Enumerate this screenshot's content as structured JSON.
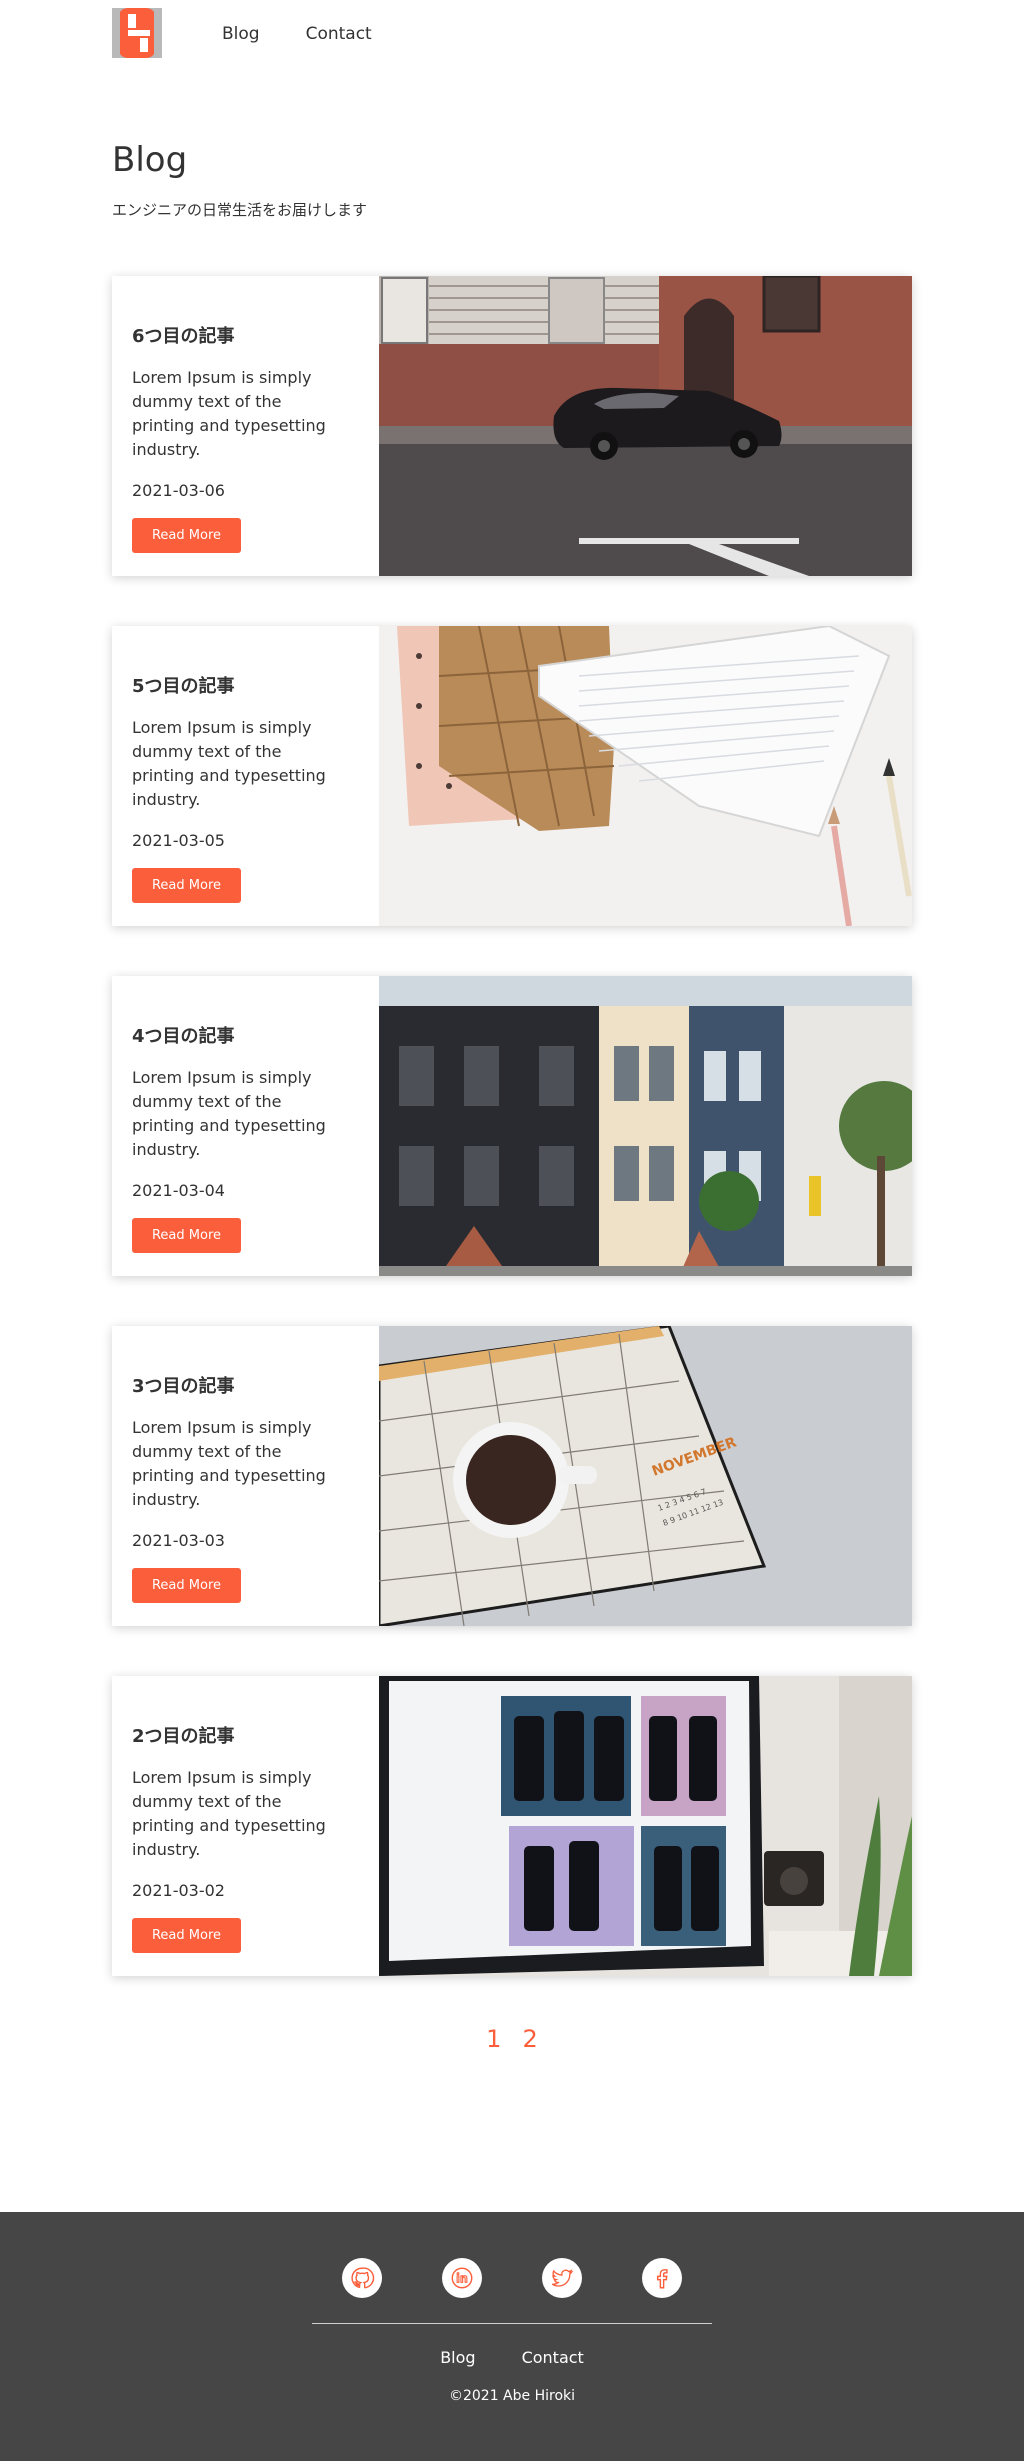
{
  "header": {
    "logo_alt": "H",
    "nav": [
      {
        "label": "Blog"
      },
      {
        "label": "Contact"
      }
    ]
  },
  "hero": {
    "title": "Blog",
    "subtitle": "エンジニアの日常生活をお届けします"
  },
  "posts": [
    {
      "title": "6つ目の記事",
      "excerpt": "Lorem Ipsum is simply dummy text of the printing and typesetting industry.",
      "date": "2021-03-06",
      "button": "Read More",
      "image": "street-car-photo"
    },
    {
      "title": "5つ目の記事",
      "excerpt": "Lorem Ipsum is simply dummy text of the printing and typesetting industry.",
      "date": "2021-03-05",
      "button": "Read More",
      "image": "notebooks-pens-photo"
    },
    {
      "title": "4つ目の記事",
      "excerpt": "Lorem Ipsum is simply dummy text of the printing and typesetting industry.",
      "date": "2021-03-04",
      "button": "Read More",
      "image": "row-houses-photo"
    },
    {
      "title": "3つ目の記事",
      "excerpt": "Lorem Ipsum is simply dummy text of the printing and typesetting industry.",
      "date": "2021-03-03",
      "button": "Read More",
      "image": "coffee-calendar-photo"
    },
    {
      "title": "2つ目の記事",
      "excerpt": "Lorem Ipsum is simply dummy text of the printing and typesetting industry.",
      "date": "2021-03-02",
      "button": "Read More",
      "image": "monitor-design-photo"
    }
  ],
  "pagination": {
    "pages": [
      "1",
      "2"
    ],
    "current": "1"
  },
  "footer": {
    "socials": [
      {
        "name": "github-icon"
      },
      {
        "name": "linkedin-icon"
      },
      {
        "name": "twitter-icon"
      },
      {
        "name": "facebook-icon"
      }
    ],
    "nav": [
      {
        "label": "Blog"
      },
      {
        "label": "Contact"
      }
    ],
    "copyright": "©2021 Abe Hiroki"
  },
  "colors": {
    "accent": "#fb5e3b",
    "footer_bg": "#464646",
    "text": "#333333"
  }
}
